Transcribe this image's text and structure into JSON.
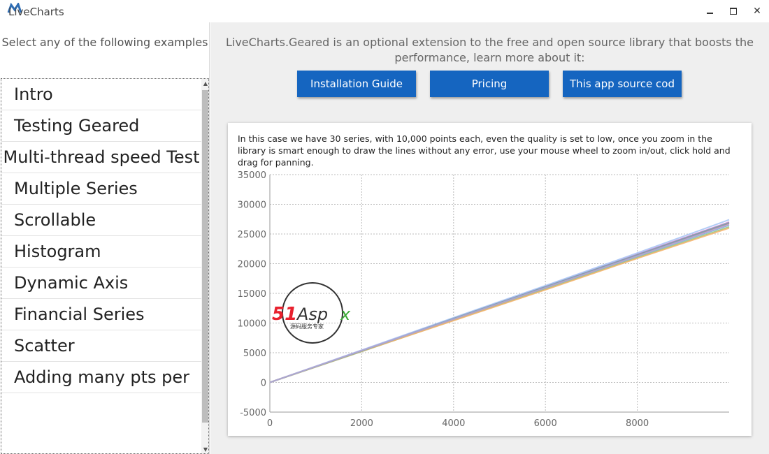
{
  "window": {
    "title": "LiveCharts",
    "minimize_icon": "minimize-icon",
    "maximize_icon": "maximize-icon",
    "close_icon": "close-icon",
    "close_glyph": "✕"
  },
  "sidebar": {
    "header": "Select any of the following examples",
    "items": [
      {
        "label": "Intro"
      },
      {
        "label": "Testing Geared"
      },
      {
        "label": "Multi-thread speed Test"
      },
      {
        "label": "Multiple Series"
      },
      {
        "label": "Scrollable"
      },
      {
        "label": "Histogram"
      },
      {
        "label": "Dynamic Axis"
      },
      {
        "label": "Financial Series"
      },
      {
        "label": "Scatter"
      },
      {
        "label": "Adding many pts per"
      }
    ],
    "scroll_up_glyph": "▲",
    "scroll_down_glyph": "▼"
  },
  "main": {
    "description": "LiveCharts.Geared is an optional extension to the free and open source library that boosts the performance, learn more about it:",
    "buttons": {
      "install": "Installation Guide",
      "pricing": "Pricing",
      "source": "This app source cod"
    },
    "card_text": "In this case we have 30 series, with 10,000 points each, even the quality is set to low, once you zoom in the library is smart enough to draw the lines without any error, use your mouse wheel to zoom in/out, click hold and drag for panning."
  },
  "watermark": {
    "brand": "51Aspx",
    "sub": "源码服务专家",
    "colors": {
      "red": "#e8212e",
      "green": "#3aa935",
      "dark": "#333333"
    }
  },
  "chart_data": {
    "type": "line",
    "title": "",
    "xlabel": "",
    "ylabel": "",
    "xlim": [
      0,
      10000
    ],
    "ylim": [
      -5000,
      35000
    ],
    "x_ticks": [
      0,
      2000,
      4000,
      6000,
      8000
    ],
    "y_ticks": [
      -5000,
      0,
      5000,
      10000,
      15000,
      20000,
      25000,
      30000,
      35000
    ],
    "x_tick_labels": [
      "0",
      "2000",
      "4000",
      "6000",
      "8000"
    ],
    "y_tick_labels": [
      "-5000",
      "0",
      "5000",
      "10000",
      "15000",
      "20000",
      "25000",
      "30000",
      "35000"
    ],
    "grid": true,
    "series_count": 30,
    "points_per_series": 10000,
    "series_sample": [
      {
        "x": [
          0,
          2000,
          4000,
          6000,
          8000,
          10000
        ],
        "y": [
          0,
          5400,
          10800,
          16200,
          21600,
          27000
        ],
        "color": "#cf7fd0"
      },
      {
        "x": [
          0,
          2000,
          4000,
          6000,
          8000,
          10000
        ],
        "y": [
          0,
          5300,
          10600,
          15900,
          21200,
          26500
        ],
        "color": "#6fa8dc"
      },
      {
        "x": [
          0,
          2000,
          4000,
          6000,
          8000,
          10000
        ],
        "y": [
          0,
          5200,
          10500,
          15700,
          21000,
          26200
        ],
        "color": "#93c47d"
      },
      {
        "x": [
          0,
          2000,
          4000,
          6000,
          8000,
          10000
        ],
        "y": [
          0,
          5350,
          10700,
          16000,
          21400,
          26800
        ],
        "color": "#e06666"
      },
      {
        "x": [
          0,
          2000,
          4000,
          6000,
          8000,
          10000
        ],
        "y": [
          0,
          5450,
          10900,
          16300,
          21800,
          27400
        ],
        "color": "#a4c2f4"
      },
      {
        "x": [
          0,
          2000,
          4000,
          6000,
          8000,
          10000
        ],
        "y": [
          0,
          5250,
          10400,
          15600,
          20900,
          26000
        ],
        "color": "#f6b26b"
      },
      {
        "x": [
          0,
          2000,
          4000,
          6000,
          8000,
          10000
        ],
        "y": [
          0,
          5300,
          10750,
          16100,
          21500,
          26900
        ],
        "color": "#76a5af"
      },
      {
        "x": [
          0,
          2000,
          4000,
          6000,
          8000,
          10000
        ],
        "y": [
          0,
          5380,
          10650,
          15950,
          21300,
          26600
        ],
        "color": "#b4a7d6"
      }
    ]
  }
}
